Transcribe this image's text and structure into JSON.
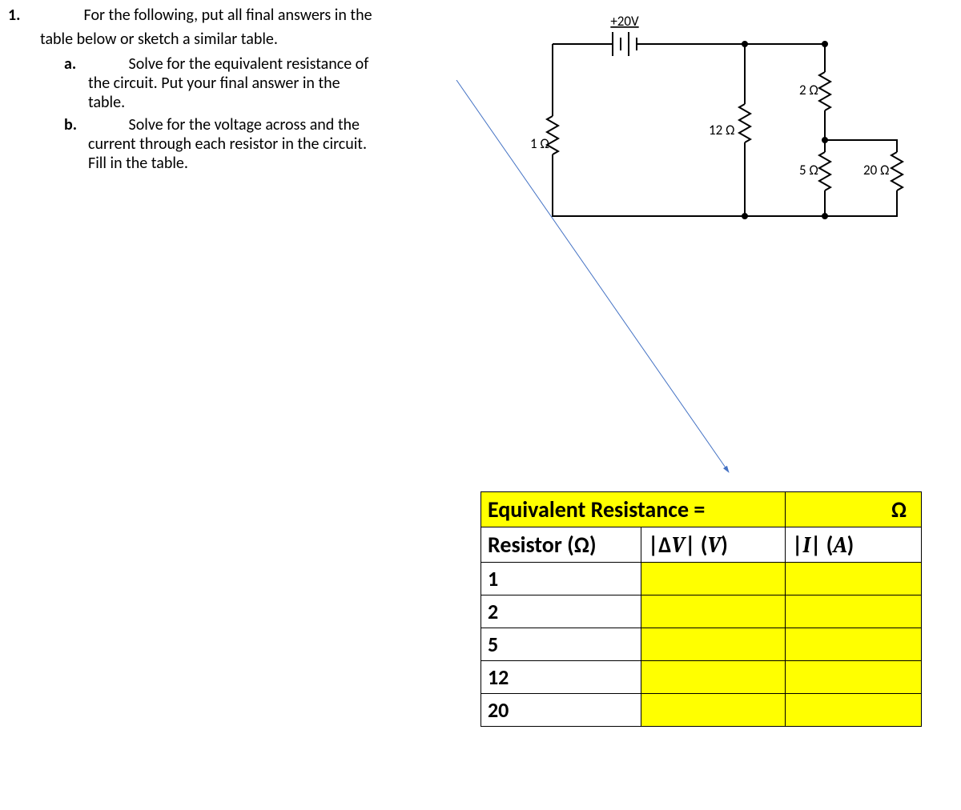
{
  "question": {
    "number": "1.",
    "text_lead": "For the following, put all final answers in the",
    "text_cont": "table below or sketch a similar table.",
    "a": {
      "letter": "a.",
      "lead": "Solve for the equivalent resistance of",
      "cont1": "the circuit.  Put your final answer in the",
      "cont2": "table."
    },
    "b": {
      "letter": "b.",
      "lead": "Solve for the voltage across and the",
      "cont1": "current through each resistor in the circuit.",
      "cont2": "Fill in the table."
    }
  },
  "circuit": {
    "source": "+20V",
    "r1": "1 Ω",
    "r12": "12 Ω",
    "r2": "2 Ω",
    "r5": "5 Ω",
    "r20": "20 Ω"
  },
  "table": {
    "eq_label": "Equivalent Resistance =",
    "omega": "Ω",
    "h_res": "Resistor (Ω)",
    "h_dv": "|ΔV| (V)",
    "h_i": "|I| (A)",
    "rows": [
      "1",
      "2",
      "5",
      "12",
      "20"
    ]
  }
}
